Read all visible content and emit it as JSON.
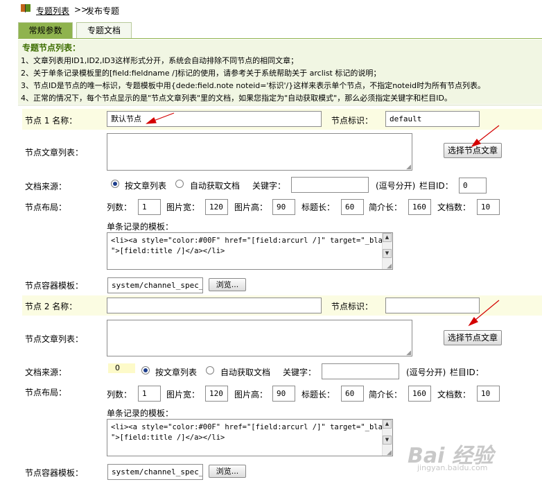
{
  "breadcrumb": {
    "link": "专题列表",
    "separator": ">>",
    "current": "发布专题"
  },
  "tabs": [
    {
      "label": "常规参数"
    },
    {
      "label": "专题文档"
    }
  ],
  "info": {
    "title": "专题节点列表：",
    "lines": [
      "1、文章列表用ID1,ID2,ID3这样形式分开，系统会自动排除不同节点的相同文章；",
      "2、关于单条记录模板里的[field:fieldname /]标记的使用，请参考关于系统帮助关于 arclist 标记的说明；",
      "3、节点ID是节点的唯一标识，专题模板中用{dede:field.note noteid='标识'/}这样来表示单个节点，不指定noteid时为所有节点列表。",
      "4、正常的情况下，每个节点显示的是\"节点文章列表\"里的文档，如果您指定为\"自动获取模式\"，那么必须指定关键字和栏目ID。"
    ]
  },
  "nodes": [
    {
      "name_label": "节点 1 名称：",
      "name_value": "默认节点",
      "id_label": "节点标识：",
      "id_value": "default",
      "list_label": "节点文章列表：",
      "select_btn": "选择节点文章",
      "source_label": "文档来源：",
      "source_option1": "按文章列表",
      "source_option2": "自动获取文档",
      "keyword_label": "关键字：",
      "keyword_value": "",
      "comma_note": "(逗号分开)",
      "column_label": "栏目ID：",
      "column_value": "0",
      "layout_label": "节点布局：",
      "cols_label": "列数：",
      "cols_value": "1",
      "imgw_label": "图片宽：",
      "imgw_value": "120",
      "imgh_label": "图片高：",
      "imgh_value": "90",
      "titlelen_label": "标题长：",
      "titlelen_value": "60",
      "introlen_label": "简介长：",
      "introlen_value": "160",
      "doccount_label": "文档数：",
      "doccount_value": "10",
      "template_label": "单条记录的模板：",
      "template_line1": "<li><a style=\"color:#00F\" href=\"[field:arcurl /]\" target=\"_blank",
      "template_line2": "\">[field:title /]</a></li>",
      "container_label": "节点容器模板：",
      "container_value": "system/channel_spec_n",
      "browse_btn": "浏览..."
    },
    {
      "name_label": "节点 2 名称：",
      "name_value": "",
      "id_label": "节点标识：",
      "id_value": "",
      "list_label": "节点文章列表：",
      "select_btn": "选择节点文章",
      "source_label": "文档来源：",
      "source_option1": "按文章列表",
      "source_option2": "自动获取文档",
      "keyword_label": "关键字：",
      "keyword_value": "",
      "comma_note": "(逗号分开)",
      "column_label": "栏目ID：",
      "column_value": "0",
      "layout_label": "节点布局：",
      "cols_label": "列数：",
      "cols_value": "1",
      "imgw_label": "图片宽：",
      "imgw_value": "120",
      "imgh_label": "图片高：",
      "imgh_value": "90",
      "titlelen_label": "标题长：",
      "titlelen_value": "60",
      "introlen_label": "简介长：",
      "introlen_value": "160",
      "doccount_label": "文档数：",
      "doccount_value": "10",
      "template_label": "单条记录的模板：",
      "template_line1": "<li><a style=\"color:#00F\" href=\"[field:arcurl /]\" target=\"_blank",
      "template_line2": "\">[field:title /]</a></li>",
      "container_label": "节点容器模板：",
      "container_value": "system/channel_spec_n",
      "browse_btn": "浏览..."
    }
  ],
  "watermark": {
    "brand": "Bai 经验",
    "url": "jingyan.baidu.com"
  },
  "colors": {
    "tab_active": "#8fb34e",
    "info_bg": "#f1f6e3",
    "info_title": "#3d6e00",
    "row_highlight": "#fbfce2",
    "arrow": "#d40000"
  }
}
